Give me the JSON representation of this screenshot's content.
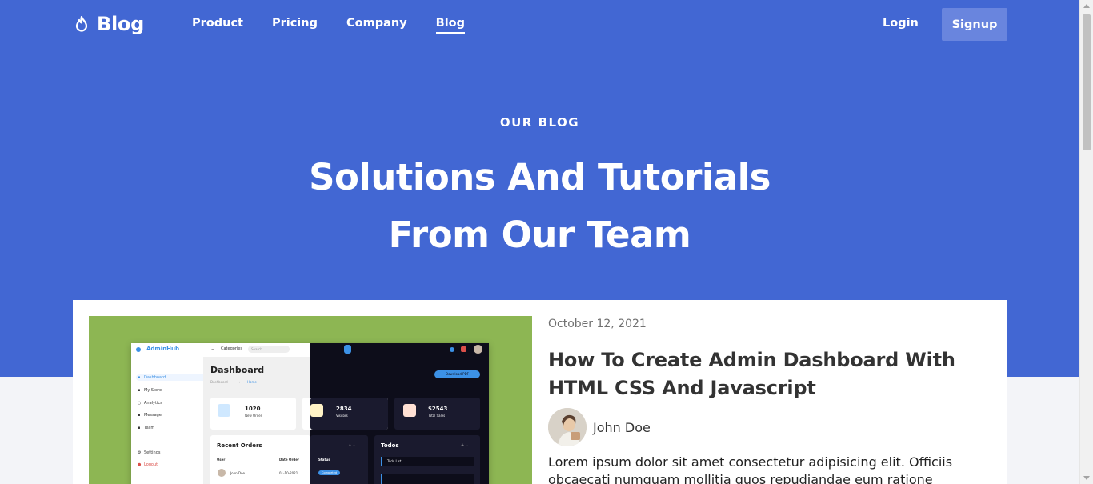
{
  "nav": {
    "logo_text": "Blog",
    "links": [
      "Product",
      "Pricing",
      "Company",
      "Blog"
    ],
    "active_link": "Blog",
    "login_label": "Login",
    "signup_label": "Signup"
  },
  "hero": {
    "eyebrow": "OUR BLOG",
    "headline_line1": "Solutions And Tutorials",
    "headline_line2": "From Our Team"
  },
  "post": {
    "date": "October 12, 2021",
    "title": "How To Create Admin Dashboard With HTML CSS And Javascript",
    "author": "John Doe",
    "excerpt": "Lorem ipsum dolor sit amet consectetur adipisicing elit. Officiis obcaecati numquam mollitia quos repudiandae eum ratione",
    "thumbnail": {
      "brand": "AdminHub",
      "nav_categories": "Categories",
      "search_placeholder": "Search...",
      "page_title": "Dashboard",
      "breadcrumb": [
        "Dashboard",
        "Home"
      ],
      "download_label": "Download PDF",
      "sidebar": [
        "Dashboard",
        "My Store",
        "Analytics",
        "Message",
        "Team"
      ],
      "sidebar_bottom": [
        "Settings",
        "Logout"
      ],
      "stats": [
        {
          "value": "1020",
          "label": "New Order"
        },
        {
          "value": "2834",
          "label": "Visitors"
        },
        {
          "value": "$2543",
          "label": "Total Sales"
        }
      ],
      "recent_orders_title": "Recent Orders",
      "orders_columns": [
        "User",
        "Date Order",
        "Status"
      ],
      "order_row": {
        "user": "John Doe",
        "date": "01-10-2021",
        "status": "Completed"
      },
      "todos_title": "Todos",
      "todo_item": "Todo List"
    }
  },
  "colors": {
    "hero_bg": "#4267d3",
    "signup_bg": "#6985de",
    "thumbnail_bg": "#8db653"
  }
}
